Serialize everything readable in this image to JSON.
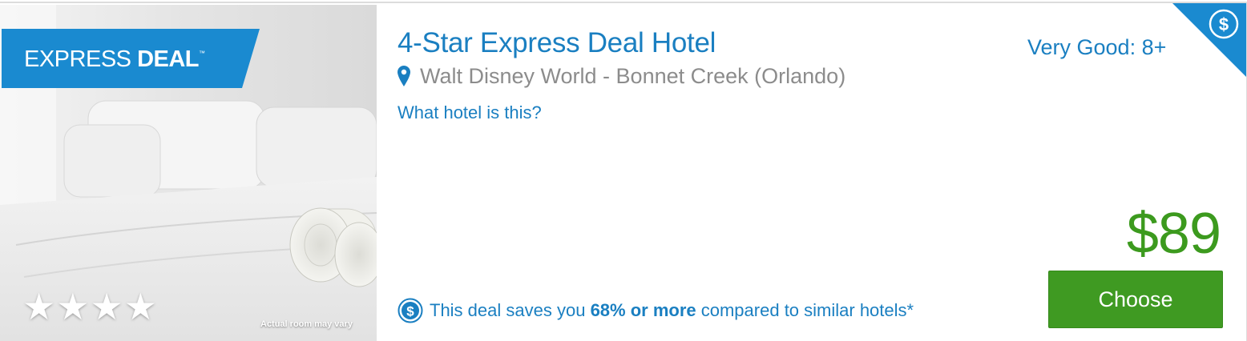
{
  "image_panel": {
    "banner": {
      "prefix": "EXPRESS",
      "bold": "DEAL",
      "tm": "™"
    },
    "stars": "★★★★",
    "star_rating": 4,
    "note": "Actual room may vary"
  },
  "hotel": {
    "title": "4-Star Express Deal Hotel",
    "location": "Walt Disney World - Bonnet Creek (Orlando)",
    "what_link": "What hotel is this?"
  },
  "rating": {
    "label": "Very Good: 8+"
  },
  "corner_badge": {
    "symbol": "$"
  },
  "savings": {
    "icon_symbol": "$",
    "prefix": "This deal saves you",
    "highlight": "68% or more",
    "suffix": "compared to similar hotels*"
  },
  "price": {
    "amount": "$89"
  },
  "choose_button": {
    "label": "Choose"
  },
  "colors": {
    "link_blue": "#1a7fc1",
    "banner_blue": "#1a8ad0",
    "price_green": "#3c9a1e",
    "button_green": "#3f9a22",
    "muted_gray": "#8c8c8c"
  }
}
